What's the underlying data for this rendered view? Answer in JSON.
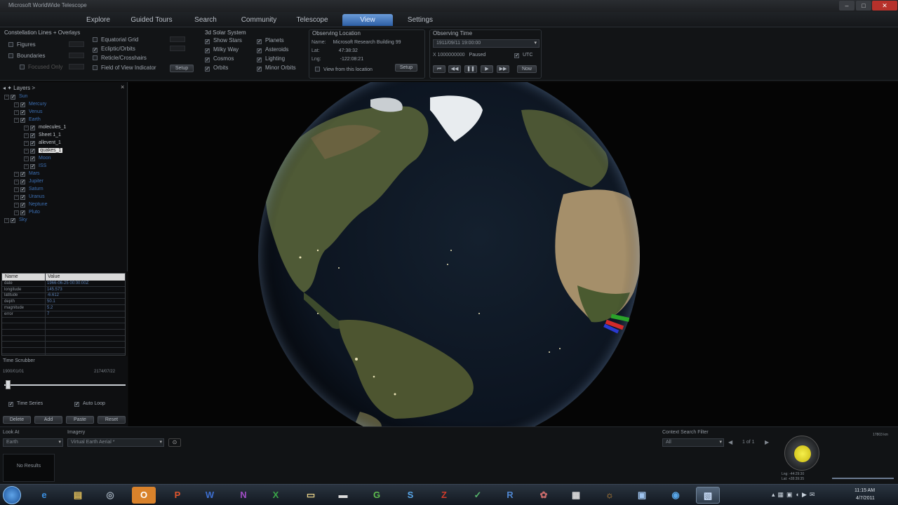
{
  "window": {
    "title": "Microsoft WorldWide Telescope",
    "close_label": "✕",
    "min_label": "–",
    "max_label": "□"
  },
  "ribbon": {
    "tabs": [
      "Explore",
      "Guided Tours",
      "Search",
      "Community",
      "Telescope",
      "View",
      "Settings"
    ],
    "active_tab": "View"
  },
  "constellations": {
    "title": "Constellation Lines + Overlays",
    "figures": "Figures",
    "boundaries": "Boundaries",
    "focused_only": "Focused Only",
    "equatorial_grid": "Equatorial Grid",
    "ecliptic_orbits": "Ecliptic/Orbits",
    "reticle": "Reticle/Crosshairs",
    "fov_indicator": "Field of View Indicator",
    "setup": "Setup"
  },
  "solar_system": {
    "title": "3d Solar System",
    "show_stars": "Show Stars",
    "milky_way": "Milky Way",
    "cosmos": "Cosmos",
    "orbits": "Orbits",
    "planets": "Planets",
    "asteroids": "Asteroids",
    "lighting": "Lighting",
    "minor_orbits": "Minor Orbits"
  },
  "observing_location": {
    "title": "Observing Location",
    "name_label": "Name:",
    "name_value": "Microsoft Research Building 99",
    "lat_label": "Lat:",
    "lat_value": "47:38:32",
    "lng_label": "Lng:",
    "lng_value": "-122:08:21",
    "view_from": "View from this location",
    "setup": "Setup"
  },
  "observing_time": {
    "title": "Observing Time",
    "datetime": "1911/09/11  19:00:00",
    "rate": "X 1000000000",
    "paused": "Paused",
    "utc": "UTC",
    "now": "Now"
  },
  "layers": {
    "title": "Layers >",
    "items": [
      {
        "label": "Sun",
        "color": "blue",
        "level": 0
      },
      {
        "label": "Mercury",
        "color": "blue",
        "level": 1
      },
      {
        "label": "Venus",
        "color": "blue",
        "level": 1
      },
      {
        "label": "Earth",
        "color": "blue",
        "level": 1
      },
      {
        "label": "molecules_1",
        "color": "white",
        "level": 2
      },
      {
        "label": "Sheet 1_1",
        "color": "white",
        "level": 2
      },
      {
        "label": "allevent_1",
        "color": "white",
        "level": 2
      },
      {
        "label": "quakes_1",
        "color": "white",
        "level": 2,
        "selected": true
      },
      {
        "label": "Moon",
        "color": "blue",
        "level": 2
      },
      {
        "label": "ISS",
        "color": "blue",
        "level": 2
      },
      {
        "label": "Mars",
        "color": "blue",
        "level": 1
      },
      {
        "label": "Jupiter",
        "color": "blue",
        "level": 1
      },
      {
        "label": "Saturn",
        "color": "blue",
        "level": 1
      },
      {
        "label": "Uranus",
        "color": "blue",
        "level": 1
      },
      {
        "label": "Neptune",
        "color": "blue",
        "level": 1
      },
      {
        "label": "Pluto",
        "color": "blue",
        "level": 1
      },
      {
        "label": "Sky",
        "color": "blue",
        "level": 0
      }
    ]
  },
  "properties": {
    "headers": [
      "Name",
      "Value"
    ],
    "rows": [
      {
        "k": "date",
        "v": "1966-06-25 00:00:00Z"
      },
      {
        "k": "longitude",
        "v": "145.573"
      },
      {
        "k": "latitude",
        "v": "-6.612"
      },
      {
        "k": "depth",
        "v": "50.1"
      },
      {
        "k": "magnitude",
        "v": "5.2"
      },
      {
        "k": "error",
        "v": "7"
      }
    ]
  },
  "time_scrubber": {
    "title": "Time Scrubber",
    "start": "1900/01/01",
    "end": "2174/07/22",
    "time_series": "Time Series",
    "auto_loop": "Auto Loop",
    "delete": "Delete",
    "add": "Add",
    "paste": "Paste",
    "reset": "Reset",
    "position": 0.01
  },
  "bottom": {
    "look_at_label": "Look At",
    "look_at_value": "Earth",
    "imagery_label": "Imagery",
    "imagery_value": "Virtual Earth Aerial *",
    "no_results": "No Results",
    "context_filter": "Context Search Filter",
    "filter_value": "All",
    "page": "1 of 1",
    "fov": "17803 km",
    "compass_lat": "Lat: +28:39:35",
    "compass_lng": "Lng: -44:29:30"
  },
  "taskbar": {
    "time": "11:15 AM",
    "date": "4/7/2011",
    "apps": [
      "start-orb",
      "ie",
      "explorer",
      "media",
      "outlook",
      "powerpoint",
      "word",
      "onenote",
      "excel",
      "folder",
      "cmd",
      "chrome",
      "skype",
      "filezilla",
      "vs",
      "r",
      "paint",
      "racing",
      "notify",
      "window",
      "globe",
      "wwt"
    ]
  }
}
